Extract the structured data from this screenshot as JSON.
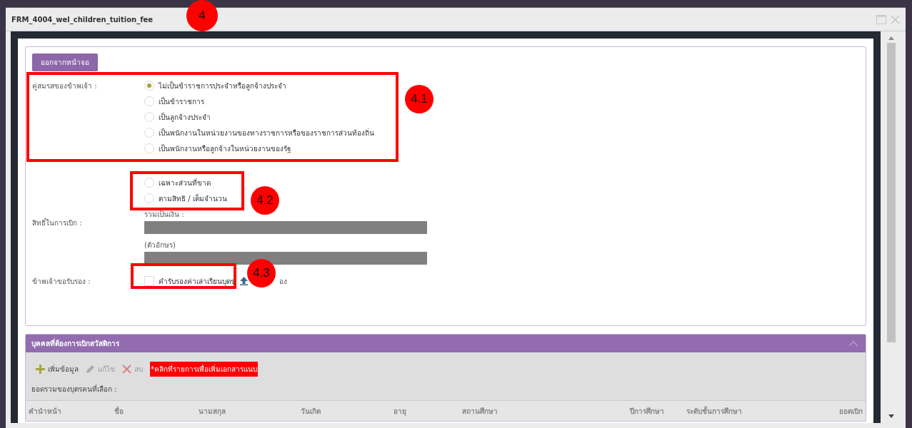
{
  "window": {
    "title": "FRM_4004_wel_children_tuition_fee"
  },
  "form": {
    "exit_button": "ออกจากหน้าจอ",
    "spouse": {
      "label": "คู่สมรสของข้าพเจ้า :",
      "options": [
        {
          "label": "ไม่เป็นข้าราชการประจำหรือลูกจ้างประจำ",
          "selected": true
        },
        {
          "label": "เป็นข้าราชการ",
          "selected": false
        },
        {
          "label": "เป็นลูกจ้างประจำ",
          "selected": false
        },
        {
          "label": "เป็นพนักงานในหน่วยงานของทางราชการหรือของราชการส่วนท้องถิ่น",
          "selected": false
        },
        {
          "label": "เป็นพนักงานหรือลูกจ้างในหน่วยงานของรัฐ",
          "selected": false
        }
      ]
    },
    "entitlement": {
      "label": "สิทธิ์ในการเบิก :",
      "options": [
        {
          "label": "เฉพาะส่วนที่ขาด",
          "selected": false
        },
        {
          "label": "ตามสิทธิ / เต็มจำนวน",
          "selected": false
        }
      ],
      "fields": [
        {
          "label": "รวมเป็นเงิน :"
        },
        {
          "label": "(ตัวอักษร)"
        }
      ]
    },
    "certify": {
      "label": "ข้าพเจ้าขอรับรอง :",
      "checkbox": {
        "label": "คำรับรองค่าเล่าเรียนบุตร",
        "checked": false
      },
      "upload_text": "อง"
    }
  },
  "persons": {
    "title": "บุคคลที่ต้องการเบิกสวัสดิการ",
    "toolbar": [
      {
        "kind": "add",
        "label": "เพิ่มข้อมูล",
        "disabled": false
      },
      {
        "kind": "edit",
        "label": "แก้ไข",
        "disabled": true
      },
      {
        "kind": "delete",
        "label": "ลบ",
        "disabled": true
      }
    ],
    "notice": "*คลิกที่รายการเพื่อเพิ่มเอกสารแนบ",
    "total_label": "ยอดรวมของบุตรคนที่เลือก :",
    "columns": [
      "คำนำหน้า",
      "ชื่อ",
      "นามสกุล",
      "วันเกิด",
      "อายุ",
      "สถานศึกษา",
      "ปีการศึกษา",
      "ระดับชั้นการศึกษา",
      "ยอดเบิก"
    ]
  },
  "annotations": [
    {
      "label": "4"
    },
    {
      "label": "4.1"
    },
    {
      "label": "4.2"
    },
    {
      "label": "4.3"
    }
  ]
}
